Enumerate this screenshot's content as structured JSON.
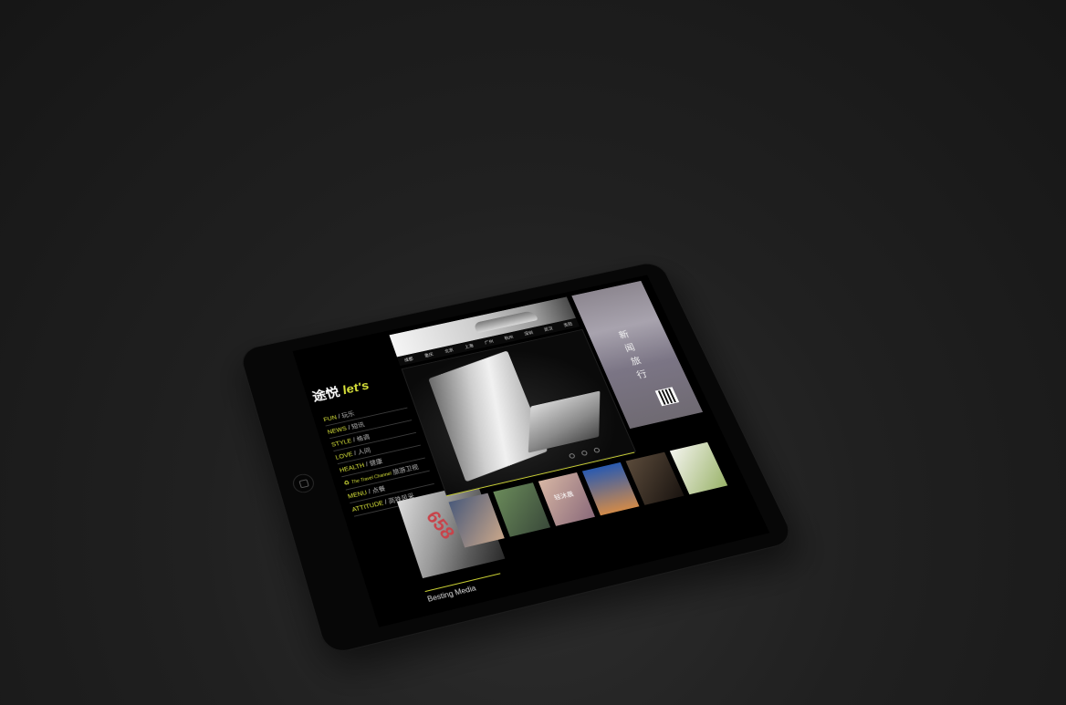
{
  "logo": {
    "cn": "途悦",
    "en": "let's"
  },
  "menu": [
    {
      "en": "FUN",
      "cn": "玩乐"
    },
    {
      "en": "NEWS",
      "cn": "短讯"
    },
    {
      "en": "STYLE",
      "cn": "格调"
    },
    {
      "en": "LOVE",
      "cn": "人间"
    },
    {
      "en": "HEALTH",
      "cn": "健康"
    },
    {
      "en": "The Travel Channel",
      "cn": "旅游卫视",
      "type": "travel"
    },
    {
      "en": "MENU",
      "cn": "点餐"
    },
    {
      "en": "ATTITUDE",
      "cn": "高铁风采"
    }
  ],
  "cities": [
    "成都",
    "重庆",
    "北京",
    "上海",
    "广州",
    "杭州",
    "深圳",
    "武汉",
    "贵阳"
  ],
  "poster": {
    "title": "新闻旅行"
  },
  "thumbnails": [
    {
      "label": ""
    },
    {
      "label": ""
    },
    {
      "label": "轻沐晨"
    },
    {
      "label": ""
    },
    {
      "label": ""
    },
    {
      "label": ""
    }
  ],
  "footer": {
    "brand": "Besting Media"
  },
  "colors": {
    "accent": "#d8e23a",
    "background": "#1c1c1c",
    "tablet": "#070707"
  },
  "icons": {
    "home": "home-button-icon",
    "apple": "apple-logo-icon",
    "travel": "recycle-icon"
  }
}
